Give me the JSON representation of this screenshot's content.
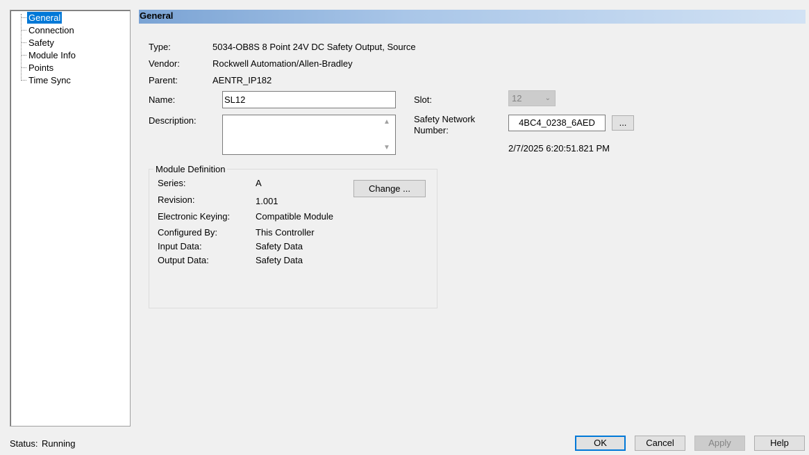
{
  "tree": {
    "items": [
      "General",
      "Connection",
      "Safety",
      "Module Info",
      "Points",
      "Time Sync"
    ],
    "selected": "General"
  },
  "header": {
    "title": "General"
  },
  "info": {
    "type_label": "Type:",
    "type_value": "5034-OB8S 8 Point 24V DC Safety Output, Source",
    "vendor_label": "Vendor:",
    "vendor_value": "Rockwell Automation/Allen-Bradley",
    "parent_label": "Parent:",
    "parent_value": "AENTR_IP182"
  },
  "form": {
    "name_label": "Name:",
    "name_value": "SL12",
    "description_label": "Description:",
    "description_value": "",
    "slot_label": "Slot:",
    "slot_value": "12",
    "safety_network_label_line1": "Safety Network",
    "safety_network_label_line2": "Number:",
    "safety_network_value": "4BC4_0238_6AED",
    "browse_button": "...",
    "timestamp": "2/7/2025 6:20:51.821 PM"
  },
  "module_definition": {
    "title": "Module Definition",
    "change_button": "Change ...",
    "rows": [
      {
        "label": "Series:",
        "value": "A"
      },
      {
        "label": "Revision:",
        "value": "1.001"
      },
      {
        "label": "Electronic Keying:",
        "value": "Compatible Module"
      },
      {
        "label": "Configured By:",
        "value": "This Controller"
      },
      {
        "label": "Input Data:",
        "value": "Safety Data"
      },
      {
        "label": "Output Data:",
        "value": "Safety Data"
      }
    ]
  },
  "footer": {
    "status_label": "Status:",
    "status_value": "Running",
    "ok": "OK",
    "cancel": "Cancel",
    "apply": "Apply",
    "help": "Help"
  },
  "colors": {
    "selection": "#0078d7",
    "header_start": "#7aa3d4",
    "header_end": "#d2e2f4"
  }
}
